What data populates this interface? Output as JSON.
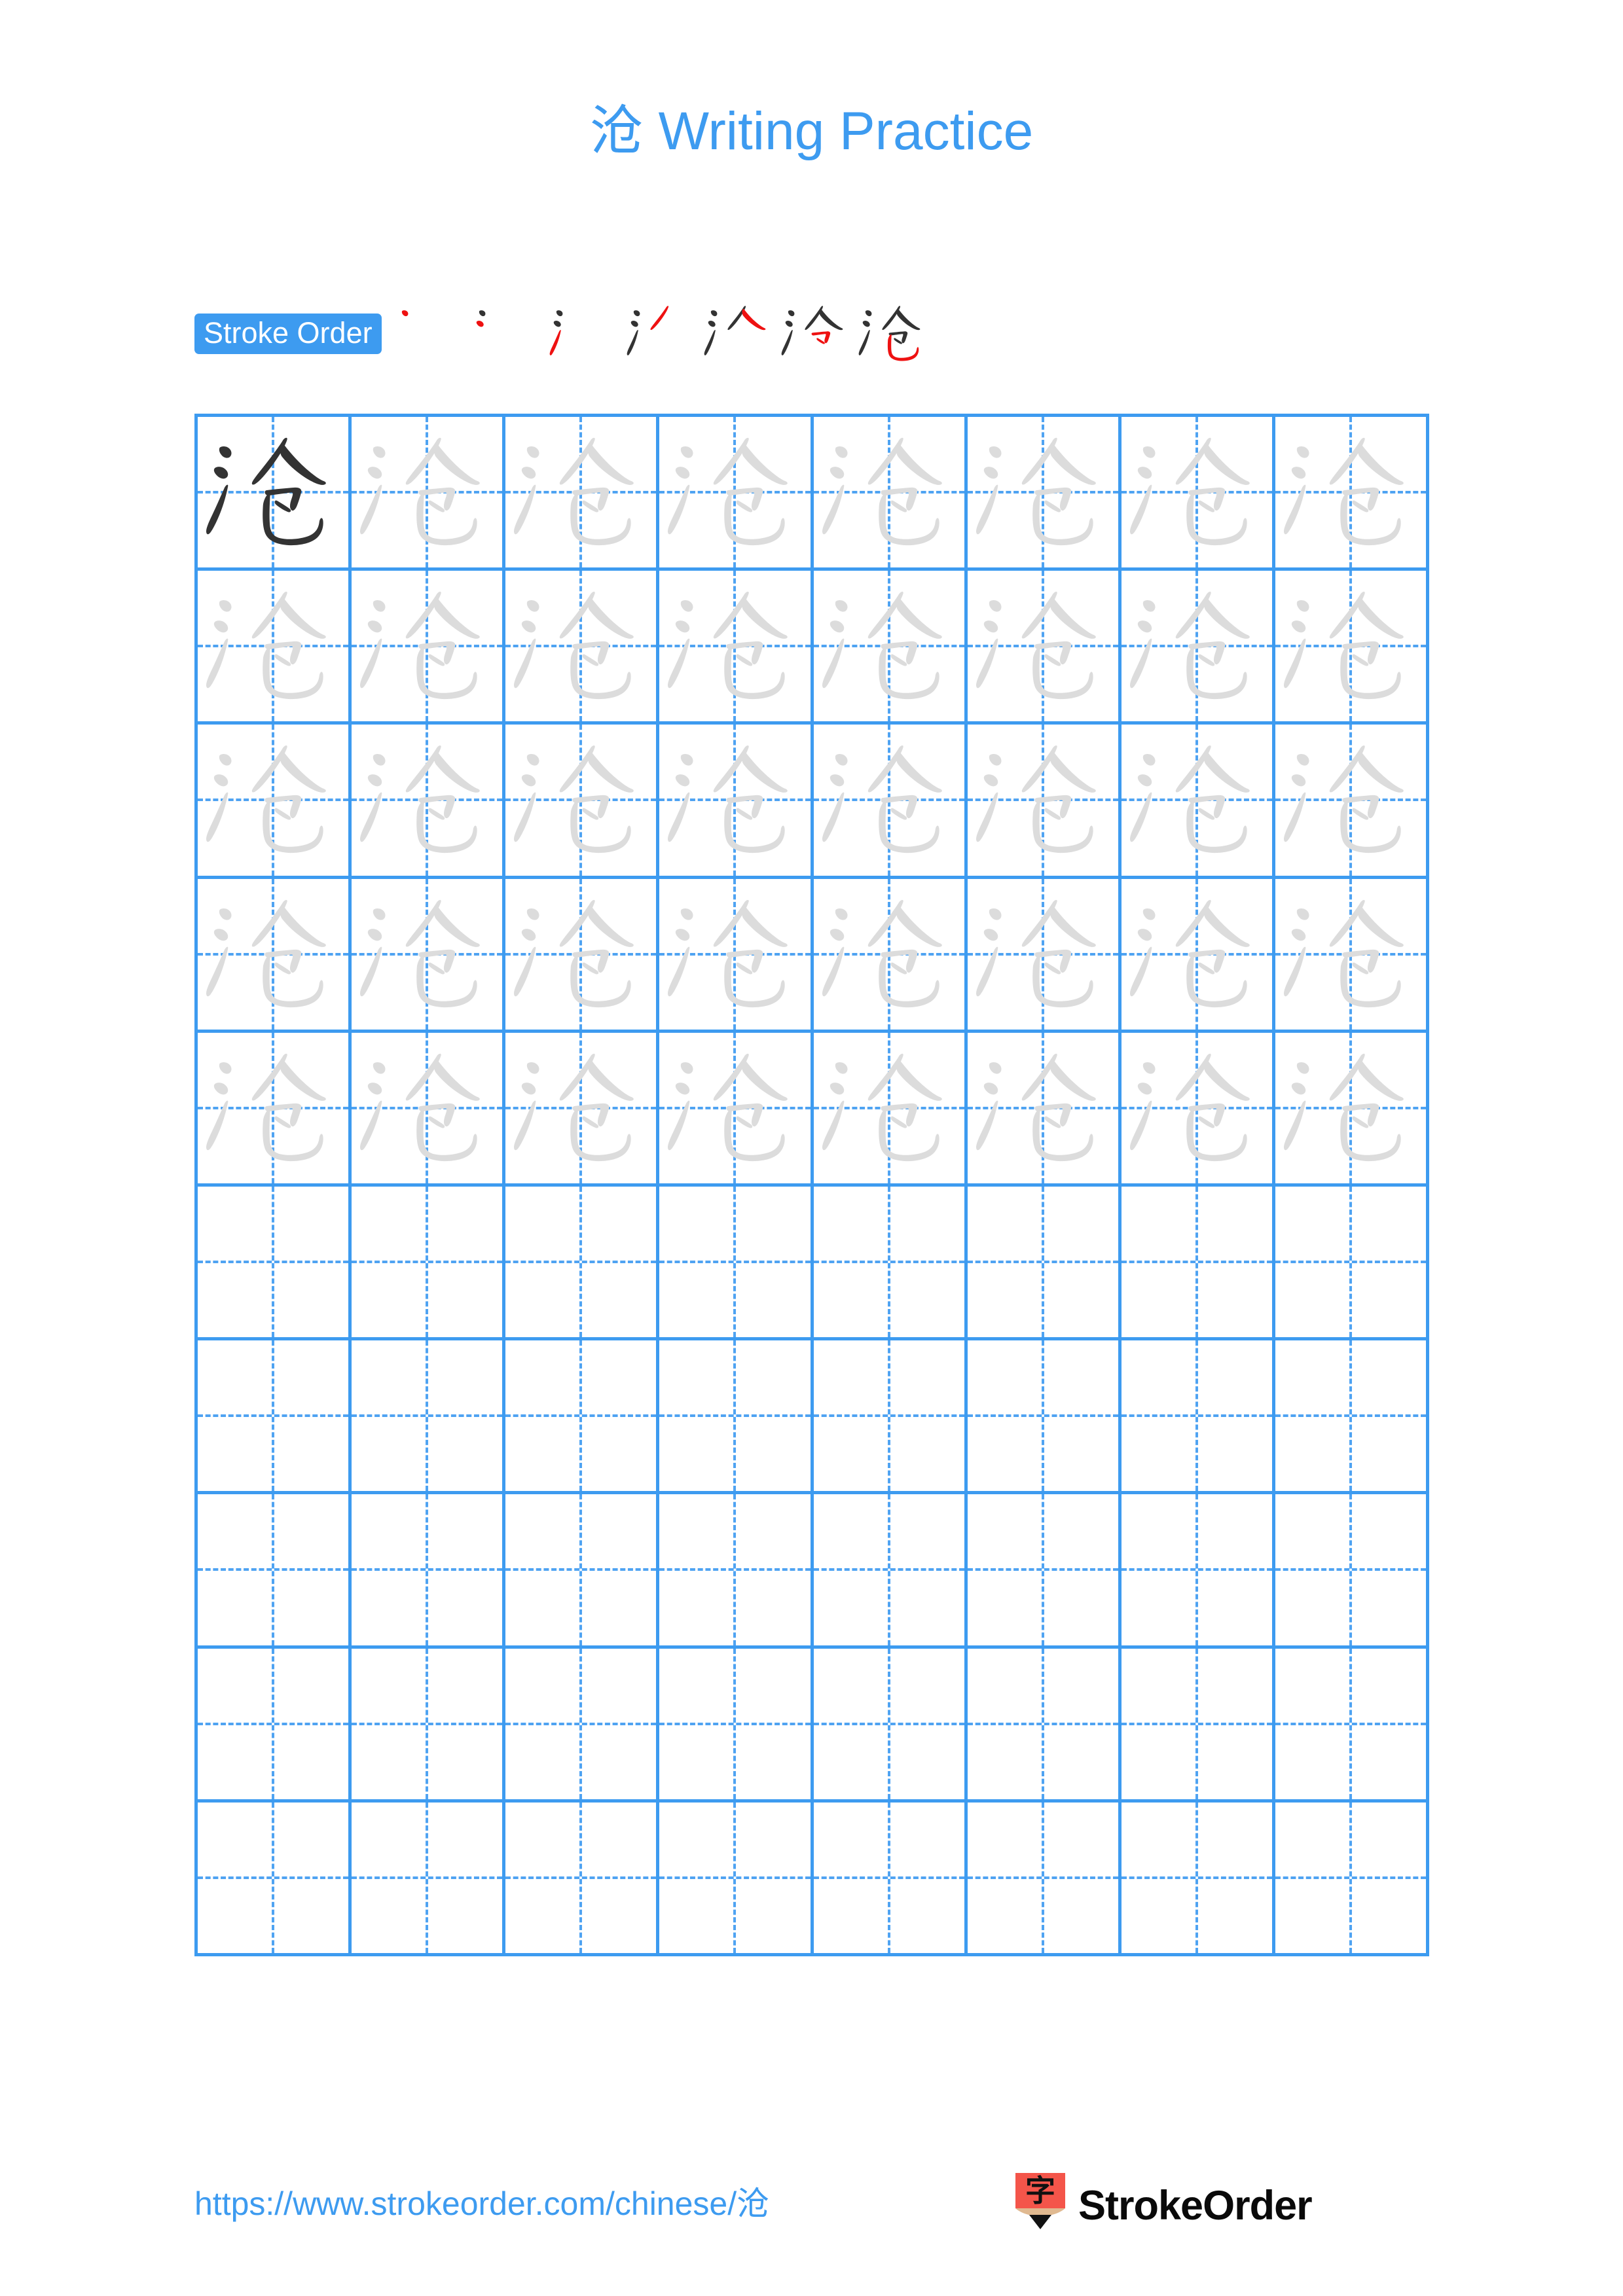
{
  "page": {
    "title": "沧 Writing Practice",
    "character": "沧",
    "background_color": "#ffffff",
    "accent_color": "#3D9BF0"
  },
  "stroke_order": {
    "badge_label": "Stroke Order",
    "badge_bg": "#3D9BF0",
    "badge_text_color": "#ffffff",
    "new_stroke_color": "#EE1111",
    "old_stroke_color": "#333333",
    "total_strokes": 7,
    "steps": [
      {
        "index": 1,
        "strokes_shown": 1
      },
      {
        "index": 2,
        "strokes_shown": 2
      },
      {
        "index": 3,
        "strokes_shown": 3
      },
      {
        "index": 4,
        "strokes_shown": 4
      },
      {
        "index": 5,
        "strokes_shown": 5
      },
      {
        "index": 6,
        "strokes_shown": 6
      },
      {
        "index": 7,
        "strokes_shown": 7
      }
    ]
  },
  "grid": {
    "columns": 8,
    "rows": 10,
    "line_color": "#3D9BF0",
    "guide_color": "#4FA3F2",
    "model_glyph_color": "#333333",
    "trace_glyph_color": "#DCDCDC",
    "filled_rows": 5,
    "model_cell_index": 0
  },
  "footer": {
    "url": "https://www.strokeorder.com/chinese/沧",
    "url_color": "#3D9BF0",
    "brand_name": "StrokeOrder",
    "logo_character": "字",
    "logo_body_color": "#F4554A",
    "logo_wood_color": "#E0B990",
    "logo_tip_color": "#111111"
  }
}
